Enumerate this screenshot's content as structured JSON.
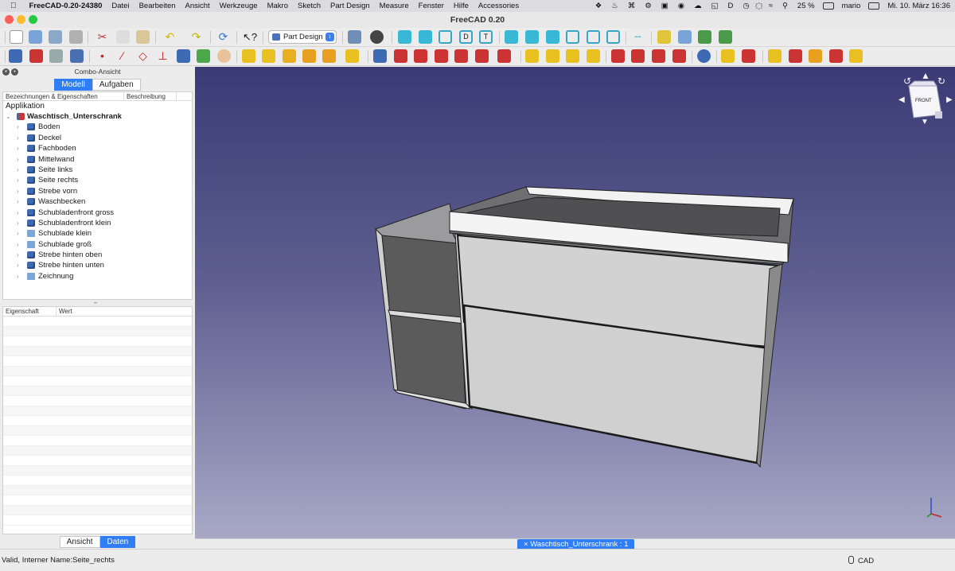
{
  "menubar": {
    "apple": "",
    "app_name": "FreeCAD-0.20-24380",
    "items": [
      "Datei",
      "Bearbeiten",
      "Ansicht",
      "Werkzeuge",
      "Makro",
      "Sketch",
      "Part Design",
      "Measure",
      "Fenster",
      "Hilfe",
      "Accessories"
    ],
    "battery": "25 %",
    "user": "mario",
    "datetime": "Mi. 10. März  16:36"
  },
  "window": {
    "title": "FreeCAD 0.20"
  },
  "toolbar": {
    "workbench": "Part Design"
  },
  "combo": {
    "title": "Combo-Ansicht",
    "tab_model": "Modell",
    "tab_tasks": "Aufgaben",
    "tree_col_labels": "Bezeichnungen & Eigenschaften",
    "tree_col_desc": "Beschreibung",
    "tree_root": "Applikation",
    "document": "Waschtisch_Unterschrank",
    "items": [
      {
        "label": "Boden",
        "icon": "part-body-icon"
      },
      {
        "label": "Deckel",
        "icon": "part-body-icon"
      },
      {
        "label": "Fachboden",
        "icon": "part-body-icon"
      },
      {
        "label": "Mittelwand",
        "icon": "part-body-icon"
      },
      {
        "label": "Seite links",
        "icon": "part-body-icon"
      },
      {
        "label": "Seite rechts",
        "icon": "part-body-icon"
      },
      {
        "label": "Strebe vorn",
        "icon": "part-body-icon"
      },
      {
        "label": "Waschbecken",
        "icon": "part-body-icon"
      },
      {
        "label": "Schubladenfront gross",
        "icon": "part-body-icon"
      },
      {
        "label": "Schubladenfront klein",
        "icon": "part-body-icon"
      },
      {
        "label": "Schublade klein",
        "icon": "folder-icon"
      },
      {
        "label": "Schublade groß",
        "icon": "folder-icon"
      },
      {
        "label": "Strebe hinten oben",
        "icon": "part-body-icon"
      },
      {
        "label": "Strebe hinten unten",
        "icon": "part-body-icon"
      },
      {
        "label": "Zeichnung",
        "icon": "folder-icon"
      }
    ],
    "prop_col_name": "Eigenschaft",
    "prop_col_value": "Wert",
    "tab_view": "Ansicht",
    "tab_data": "Daten"
  },
  "viewport": {
    "navcube_face": "FRONT",
    "doc_tab": "Waschtisch_Unterschrank : 1"
  },
  "status": {
    "message": "Valid, Interner Name:Seite_rechts",
    "nav_style": "CAD"
  },
  "colors": {
    "accent": "#2f7ef6",
    "viewport_top": "#3a3b75",
    "viewport_bottom": "#a8a8c6"
  }
}
